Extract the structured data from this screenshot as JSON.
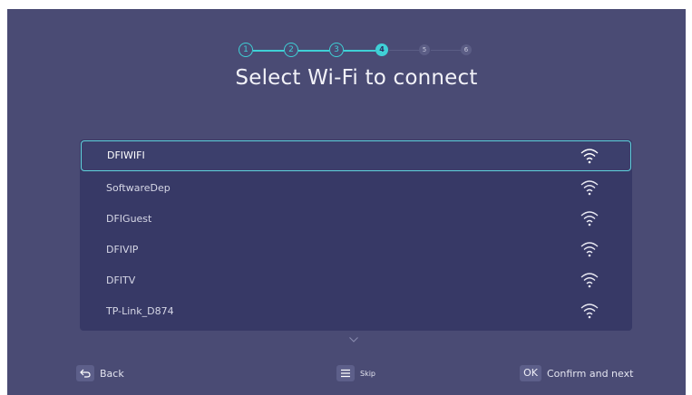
{
  "stepper": {
    "steps": [
      {
        "label": "1",
        "state": "done"
      },
      {
        "label": "2",
        "state": "done"
      },
      {
        "label": "3",
        "state": "done"
      },
      {
        "label": "4",
        "state": "current"
      },
      {
        "label": "5",
        "state": "future"
      },
      {
        "label": "6",
        "state": "future"
      }
    ],
    "accent_color": "#3fd0d6"
  },
  "title": "Select Wi-Fi to connect",
  "networks": [
    {
      "name": "DFIWIFI",
      "selected": true,
      "icon": "wifi-icon"
    },
    {
      "name": "SoftwareDep",
      "selected": false,
      "icon": "wifi-icon"
    },
    {
      "name": "DFIGuest",
      "selected": false,
      "icon": "wifi-icon"
    },
    {
      "name": "DFIVIP",
      "selected": false,
      "icon": "wifi-icon"
    },
    {
      "name": "DFITV",
      "selected": false,
      "icon": "wifi-icon"
    },
    {
      "name": "TP-Link_D874",
      "selected": false,
      "icon": "wifi-icon"
    }
  ],
  "footer": {
    "back": {
      "key_icon": "back-arrow-icon",
      "label": "Back"
    },
    "skip": {
      "key_icon": "menu-icon",
      "label": "Skip"
    },
    "confirm": {
      "key": "OK",
      "label": "Confirm and next"
    }
  },
  "colors": {
    "background": "#4a4b74",
    "list_background": "#373966",
    "selection_border": "#5fd3dc"
  }
}
